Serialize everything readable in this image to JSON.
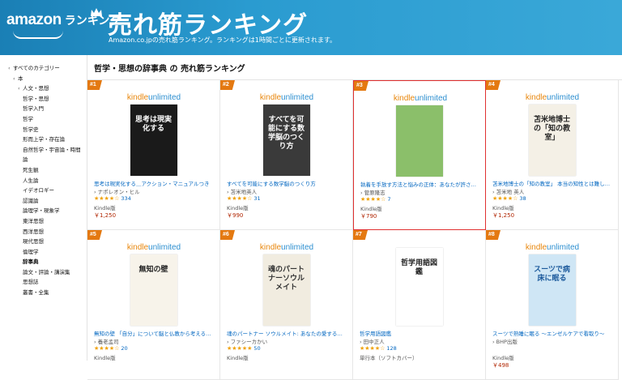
{
  "header": {
    "logo_amazon": "amazon",
    "logo_ranking": "ランキング",
    "title": "売れ筋ランキング",
    "subtitle": "Amazon.co.jpの売れ筋ランキング。ランキングは1時間ごとに更新されます。"
  },
  "sidebar": {
    "items": [
      {
        "label": "すべてのカテゴリー",
        "level": 0,
        "caret": "‹"
      },
      {
        "label": "本",
        "level": 1,
        "caret": "‹"
      },
      {
        "label": "人文・思想",
        "level": 2,
        "caret": "‹"
      },
      {
        "label": "哲学・思想",
        "level": 3,
        "caret": ""
      },
      {
        "label": "哲学入門",
        "level": 3,
        "caret": ""
      },
      {
        "label": "哲学",
        "level": 3,
        "caret": ""
      },
      {
        "label": "哲学史",
        "level": 3,
        "caret": ""
      },
      {
        "label": "形而上学・存在論",
        "level": 3,
        "caret": ""
      },
      {
        "label": "自然哲学・宇宙論・時間",
        "level": 3,
        "caret": ""
      },
      {
        "label": "論",
        "level": 3,
        "caret": ""
      },
      {
        "label": "死生観",
        "level": 3,
        "caret": ""
      },
      {
        "label": "人生論",
        "level": 3,
        "caret": ""
      },
      {
        "label": "イデオロギー",
        "level": 3,
        "caret": ""
      },
      {
        "label": "認識論",
        "level": 3,
        "caret": ""
      },
      {
        "label": "論理学・現象学",
        "level": 3,
        "caret": ""
      },
      {
        "label": "東洋思想",
        "level": 3,
        "caret": ""
      },
      {
        "label": "西洋思想",
        "level": 3,
        "caret": ""
      },
      {
        "label": "現代思想",
        "level": 3,
        "caret": ""
      },
      {
        "label": "倫理学",
        "level": 3,
        "caret": ""
      },
      {
        "label": "辞事典",
        "level": 3,
        "caret": "",
        "bold": true
      },
      {
        "label": "論文・評論・講演集",
        "level": 3,
        "caret": ""
      },
      {
        "label": "思想誌",
        "level": 3,
        "caret": ""
      },
      {
        "label": "叢書・全集",
        "level": 3,
        "caret": ""
      }
    ]
  },
  "main": {
    "title": "哲学・思想の辞事典 の 売れ筋ランキング"
  },
  "kindle_unlimited": {
    "a": "kindle",
    "b": "unlimited"
  },
  "books": [
    {
      "rank": "#1",
      "ku": true,
      "title": "思考は現実化する＿アクション・マニュアルつき",
      "author": "ナポレオン・ヒル",
      "stars": "★★★★☆",
      "count": "334",
      "format": "Kindle版",
      "price": "￥1,250",
      "cover_bg": "#1a1a1a",
      "cover_text": "思考は現実化する",
      "cover_fg": "#ffffff"
    },
    {
      "rank": "#2",
      "ku": true,
      "title": "すべてを可能にする数学脳のつくり方",
      "author": "苫米地英人",
      "stars": "★★★★☆",
      "count": "31",
      "format": "Kindle版",
      "price": "￥990",
      "cover_bg": "#3a3a3a",
      "cover_text": "すべてを可能にする数学脳のつくり方",
      "cover_fg": "#ffffff"
    },
    {
      "rank": "#3",
      "ku": true,
      "title": "執着を手放す方法と悩みの正体：あなたが許さ…",
      "author": "菅原隆志",
      "stars": "★★★★☆",
      "count": "7",
      "format": "Kindle版",
      "price": "￥790",
      "cover_bg": "#8bbf6a",
      "cover_text": "",
      "cover_fg": "#ffffff"
    },
    {
      "rank": "#4",
      "ku": true,
      "title": "苫米地博士の「知の教室」 本当の知性とは難し…",
      "author": "苫米地 英人",
      "stars": "★★★★☆",
      "count": "38",
      "format": "Kindle版",
      "price": "￥1,250",
      "cover_bg": "#f4f0e6",
      "cover_text": "苫米地博士の「知の教室」",
      "cover_fg": "#222222"
    },
    {
      "rank": "#5",
      "ku": true,
      "title": "無知の壁 「自分」について脳と仏教から考える…",
      "author": "養老孟司",
      "stars": "★★★★☆",
      "count": "20",
      "format": "Kindle版",
      "price": "",
      "cover_bg": "#f7f3ea",
      "cover_text": "無知の壁",
      "cover_fg": "#222222"
    },
    {
      "rank": "#6",
      "ku": true,
      "title": "魂のパートナー ソウルメイト: あなたの愛する…",
      "author": "ファシーカかい",
      "stars": "★★★★★",
      "count": "50",
      "format": "Kindle版",
      "price": "",
      "cover_bg": "#f1ece0",
      "cover_text": "魂のパートナーソウルメイト",
      "cover_fg": "#333333"
    },
    {
      "rank": "#7",
      "ku": false,
      "title": "哲学用語図鑑",
      "author": "田中正人",
      "stars": "★★★★☆",
      "count": "128",
      "format": "単行本（ソフトカバー）",
      "price": "",
      "cover_bg": "#ffffff",
      "cover_text": "哲学用語図鑑",
      "cover_fg": "#222222"
    },
    {
      "rank": "#8",
      "ku": true,
      "title": "スーツで熟睡に眠る ～エンゼルケアで看取り～",
      "author": "BHP出版",
      "stars": "",
      "count": "",
      "format": "Kindle版",
      "price": "￥498",
      "cover_bg": "#cfe6f5",
      "cover_text": "スーツで病床に眠る",
      "cover_fg": "#1c5a9c"
    }
  ]
}
